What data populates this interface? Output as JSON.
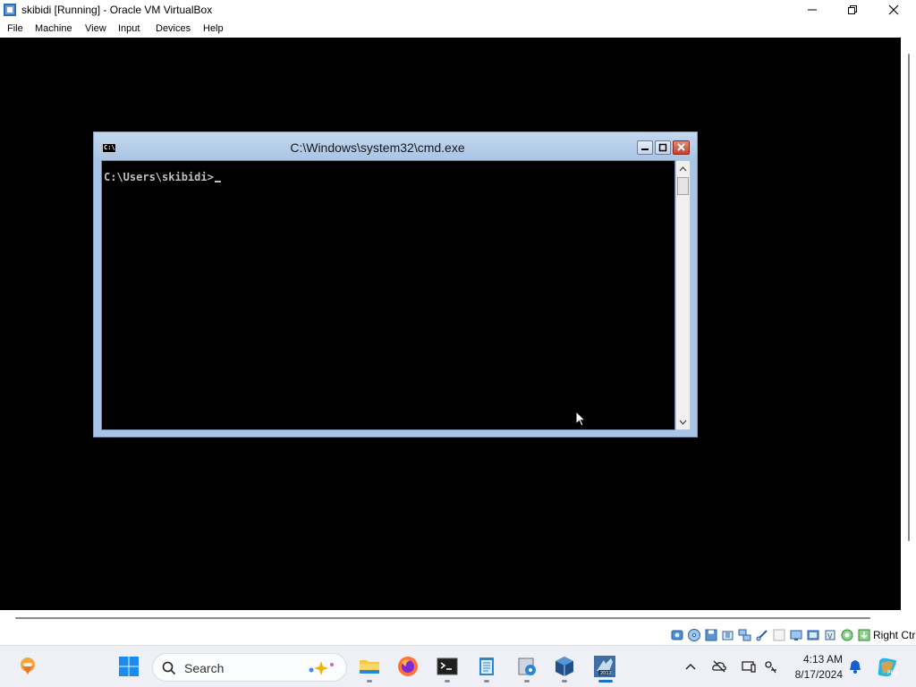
{
  "host_window": {
    "title": "skibidi [Running] - Oracle VM VirtualBox",
    "menu": [
      "File",
      "Machine",
      "View",
      "Input",
      "Devices",
      "Help"
    ]
  },
  "guest": {
    "cmd_window": {
      "title": "C:\\Windows\\system32\\cmd.exe",
      "icon_text": "C:\\",
      "prompt": "C:\\Users\\skibidi>"
    }
  },
  "status_bar": {
    "icons": [
      "hard-disk-icon",
      "optical-drive-icon",
      "floppy-icon",
      "audio-icon",
      "network-icon",
      "usb-icon",
      "shared-folders-icon",
      "display-icon",
      "recording-icon",
      "cpu-icon",
      "mouse-integration-icon",
      "keyboard-icon"
    ],
    "host_key": "Right Ctrl"
  },
  "taskbar": {
    "search_placeholder": "Search",
    "clock_time": "4:13 AM",
    "clock_date": "8/17/2024",
    "apps": [
      "widgets-icon",
      "start-icon",
      "file-explorer-icon",
      "firefox-icon",
      "terminal-icon",
      "notepad-icon",
      "disk-manager-icon",
      "virtualbox-icon",
      "server-2012-icon"
    ],
    "tray": [
      "chevron-up-icon",
      "onedrive-icon",
      "devices-icon",
      "network-tray-icon",
      "notifications-bell-icon",
      "copilot-icon"
    ]
  },
  "colors": {
    "cmd_frame": "#a9c4e4",
    "console_bg": "#000000",
    "console_text": "#c0c0c0",
    "cmd_close": "#c8412c",
    "taskbar_bg": "#eef0f5"
  }
}
